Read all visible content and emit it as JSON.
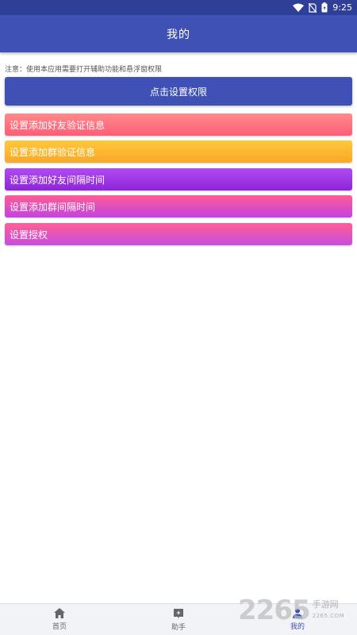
{
  "status_bar": {
    "time": "9:25"
  },
  "header": {
    "title": "我的"
  },
  "notice": "注意：使用本应用需要打开辅助功能和悬浮窗权限",
  "permission_button": {
    "label": "点击设置权限"
  },
  "menu_items": [
    {
      "label": "设置添加好友验证信息",
      "color": "#ff6f7f"
    },
    {
      "label": "设置添加群验证信息",
      "color": "#fbb530"
    },
    {
      "label": "设置添加好友间隔时间",
      "color": "#a13ae6"
    },
    {
      "label": "设置添加群间隔时间",
      "color": "#e84fb8"
    },
    {
      "label": "设置授权",
      "color": "#e552b8"
    }
  ],
  "bottom_nav": {
    "items": [
      {
        "label": "首页",
        "icon": "home-icon",
        "active": false
      },
      {
        "label": "助手",
        "icon": "assistant-icon",
        "active": false
      },
      {
        "label": "我的",
        "icon": "person-icon",
        "active": true
      }
    ]
  },
  "watermark": {
    "number": "2265",
    "text": "手游网",
    "sub": "2265.COM"
  },
  "colors": {
    "primary": "#3f51b5",
    "primary_dark": "#2f3f98",
    "nav_background": "#f2f3f7"
  }
}
